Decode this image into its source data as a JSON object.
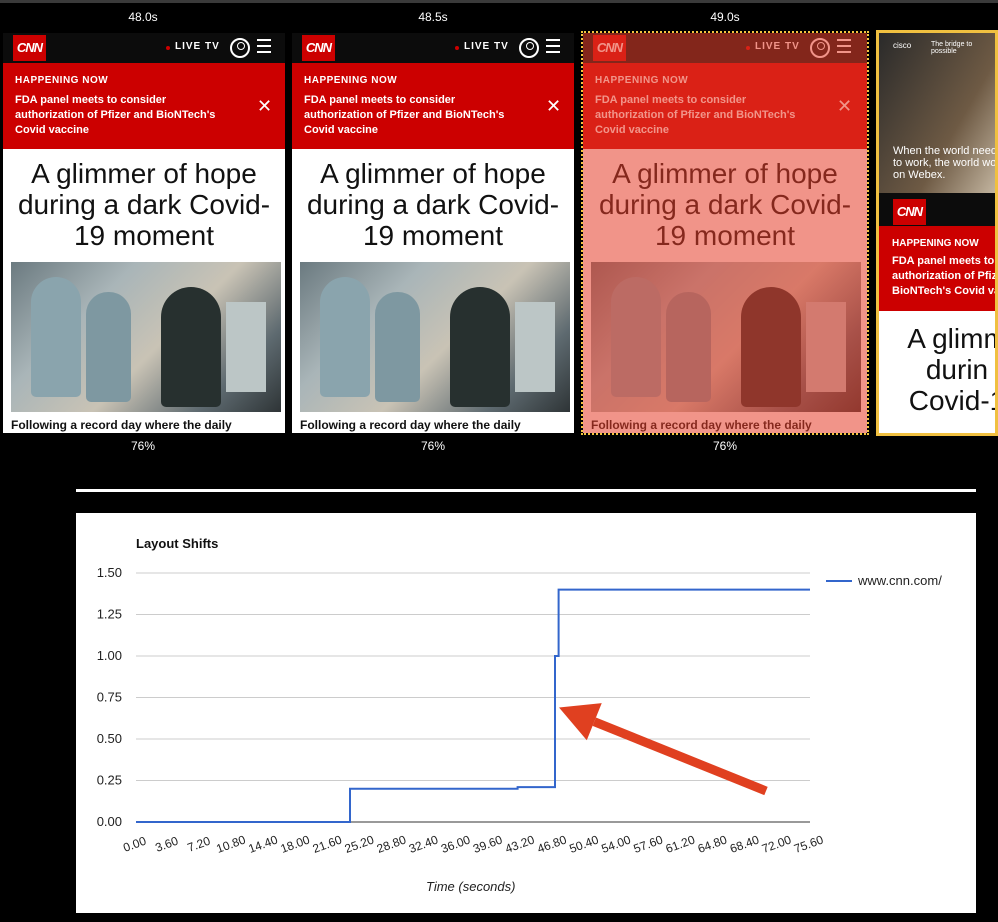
{
  "filmstrip": {
    "frames": [
      {
        "timestamp": "48.0s",
        "visual_complete": "76%",
        "style": "normal"
      },
      {
        "timestamp": "48.5s",
        "visual_complete": "76%",
        "style": "normal"
      },
      {
        "timestamp": "49.0s",
        "visual_complete": "76%",
        "style": "highlighted-shift"
      },
      {
        "timestamp": "",
        "visual_complete": "",
        "style": "partial"
      }
    ],
    "page": {
      "logo": "CNN",
      "live_tv": "LIVE TV",
      "happening_now": "HAPPENING NOW",
      "alert_text": "FDA panel meets to consider authorization of Pfizer and BioNTech's Covid vaccine",
      "headline": "A glimmer of hope during a dark Covid-19 moment",
      "caption": "Following a record day where the daily",
      "ad_brand": "cisco",
      "ad_tagline": "The bridge to possible",
      "ad_text": "When the world needs to work, the world works on Webex.",
      "partial_headline": "A glimm durin Covid-1"
    }
  },
  "chart_data": {
    "type": "line",
    "title": "Layout Shifts",
    "xlabel": "Time (seconds)",
    "ylabel": "",
    "xlim": [
      0,
      75.6
    ],
    "ylim": [
      0,
      1.5
    ],
    "x_ticks": [
      "0.00",
      "3.60",
      "7.20",
      "10.80",
      "14.40",
      "18.00",
      "21.60",
      "25.20",
      "28.80",
      "32.40",
      "36.00",
      "39.60",
      "43.20",
      "46.80",
      "50.40",
      "54.00",
      "57.60",
      "61.20",
      "64.80",
      "68.40",
      "72.00",
      "75.60"
    ],
    "y_ticks": [
      "0.00",
      "0.25",
      "0.50",
      "0.75",
      "1.00",
      "1.25",
      "1.50"
    ],
    "grid": true,
    "legend_position": "right",
    "series": [
      {
        "name": "www.cnn.com/",
        "color": "#3366cc",
        "points": [
          [
            0,
            0
          ],
          [
            24.0,
            0
          ],
          [
            24.0,
            0.2
          ],
          [
            42.8,
            0.2
          ],
          [
            42.8,
            0.21
          ],
          [
            47.0,
            0.21
          ],
          [
            47.0,
            1.0
          ],
          [
            47.4,
            1.0
          ],
          [
            47.4,
            1.4
          ],
          [
            75.6,
            1.4
          ]
        ]
      }
    ],
    "annotation": {
      "type": "arrow",
      "color": "#e04020",
      "points_at": [
        47.0,
        0.69
      ]
    }
  }
}
